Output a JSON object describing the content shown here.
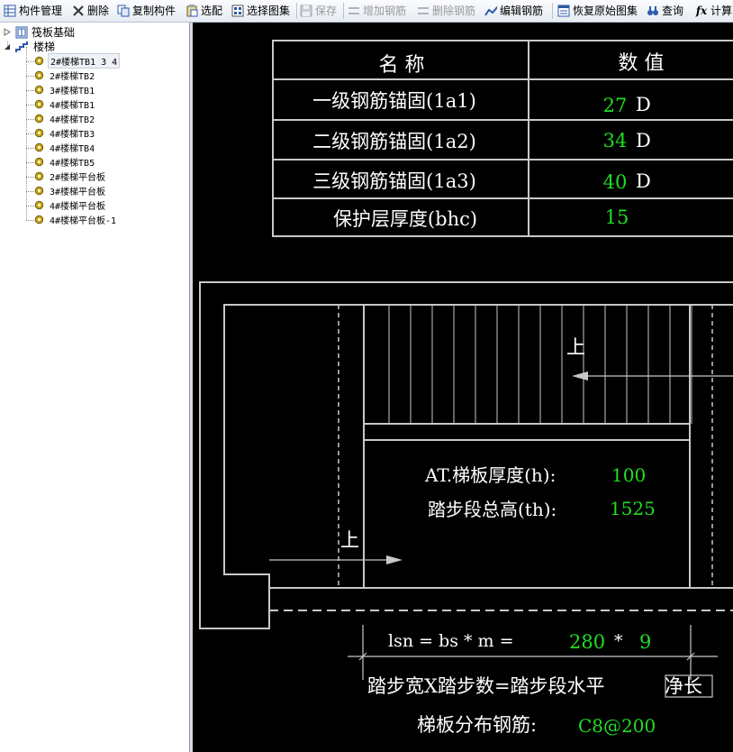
{
  "toolbar": {
    "component_manage": "构件管理",
    "delete": "删除",
    "copy_component": "复制构件",
    "select_match": "选配",
    "select_atlas": "选择图集",
    "save": "保存",
    "add_rebar": "增加钢筋",
    "delete_rebar": "删除钢筋",
    "edit_rebar": "编辑钢筋",
    "restore_atlas": "恢复原始图集",
    "query": "查询",
    "calculate": "计算"
  },
  "tree": {
    "root1": "筏板基础",
    "root2": "楼梯",
    "items": [
      "2#楼梯TB1 3 4",
      "2#楼梯TB2",
      "3#楼梯TB1",
      "4#楼梯TB1",
      "4#楼梯TB2",
      "4#楼梯TB3",
      "4#楼梯TB4",
      "4#楼梯TB5",
      "2#楼梯平台板",
      "3#楼梯平台板",
      "4#楼梯平台板",
      "4#楼梯平台板-1"
    ],
    "selected_index": 0
  },
  "table": {
    "head_name": "名  称",
    "head_value": "数  值",
    "rows": [
      {
        "name": "一级钢筋锚固(1a1)",
        "value": "27",
        "unit": "D"
      },
      {
        "name": "二级钢筋锚固(1a2)",
        "value": "34",
        "unit": "D"
      },
      {
        "name": "三级钢筋锚固(1a3)",
        "value": "40",
        "unit": "D"
      },
      {
        "name": "保护层厚度(bhc)",
        "value": "15",
        "unit": ""
      }
    ]
  },
  "drawing": {
    "up_label": "上",
    "thickness_label": "AT.梯板厚度(h):",
    "thickness_value": "100",
    "total_height_label": "踏步段总高(th):",
    "total_height_value": "1525",
    "lsn_label": "lsn = bs * m =",
    "step_width_value": "280",
    "times": "*",
    "step_count_value": "9",
    "formula_text_a": "踏步宽X踏步数=踏步段水平",
    "formula_text_b": "净长",
    "distribution_label": "梯板分布钢筋:",
    "distribution_value": "C8@200"
  },
  "colors": {
    "canvas_bg": "#000000",
    "cad_white": "#ffffff",
    "cad_green": "#22dd22",
    "cad_gray_line": "#c8c8c8"
  }
}
